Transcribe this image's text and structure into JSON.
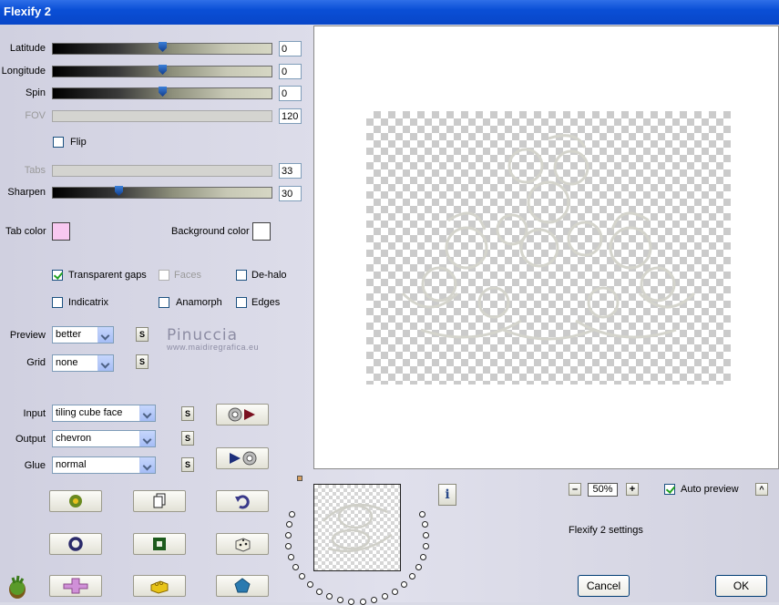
{
  "window": {
    "title": "Flexify 2"
  },
  "sliders": [
    {
      "id": "latitude",
      "label": "Latitude",
      "value": "0",
      "level": 0.5,
      "enabled": true
    },
    {
      "id": "longitude",
      "label": "Longitude",
      "value": "0",
      "level": 0.5,
      "enabled": true
    },
    {
      "id": "spin",
      "label": "Spin",
      "value": "0",
      "level": 0.5,
      "enabled": true
    },
    {
      "id": "fov",
      "label": "FOV",
      "value": "120",
      "enabled": false
    },
    {
      "id": "tabs",
      "label": "Tabs",
      "value": "33",
      "enabled": false
    },
    {
      "id": "sharpen",
      "label": "Sharpen",
      "value": "30",
      "level": 0.3,
      "enabled": true
    }
  ],
  "flip": {
    "label": "Flip",
    "checked": false
  },
  "colors": {
    "tab_color_label": "Tab color",
    "tab_color": "#f8c8f0",
    "background_color_label": "Background color",
    "background_color": "#ffffff"
  },
  "options": {
    "transparent_gaps": {
      "label": "Transparent gaps",
      "checked": true
    },
    "faces": {
      "label": "Faces",
      "checked": false,
      "enabled": false
    },
    "dehalo": {
      "label": "De-halo",
      "checked": false
    },
    "indicatrix": {
      "label": "Indicatrix",
      "checked": false
    },
    "anamorph": {
      "label": "Anamorph",
      "checked": false
    },
    "edges": {
      "label": "Edges",
      "checked": false
    }
  },
  "preview_select": {
    "label": "Preview",
    "value": "better"
  },
  "grid_select": {
    "label": "Grid",
    "value": "none"
  },
  "input_select": {
    "label": "Input",
    "value": "tiling cube face"
  },
  "output_select": {
    "label": "Output",
    "value": "chevron"
  },
  "glue_select": {
    "label": "Glue",
    "value": "normal"
  },
  "s_label": "S",
  "watermark": {
    "name": "Pinuccia",
    "site": "www.maidiregrafica.eu"
  },
  "zoom": {
    "value": "50%",
    "minus": "–",
    "plus": "+"
  },
  "auto_preview": {
    "label": "Auto preview",
    "checked": true
  },
  "collapse_label": "^",
  "settings_text": "Flexify 2 settings",
  "info_label": "i",
  "buttons": {
    "cancel": "Cancel",
    "ok": "OK"
  },
  "icons": {
    "play_right": "disc-arrow-icon",
    "play_left": "arrow-disc-icon",
    "randomize": "flower-icon",
    "copy": "copy-icon",
    "undo": "undo-icon",
    "ring": "ring-icon",
    "square": "square-icon",
    "dice": "dice-icon",
    "cross": "cross-icon",
    "brick": "brick-icon",
    "pentagon": "pentagon-icon",
    "logo": "flexify-logo-icon"
  }
}
